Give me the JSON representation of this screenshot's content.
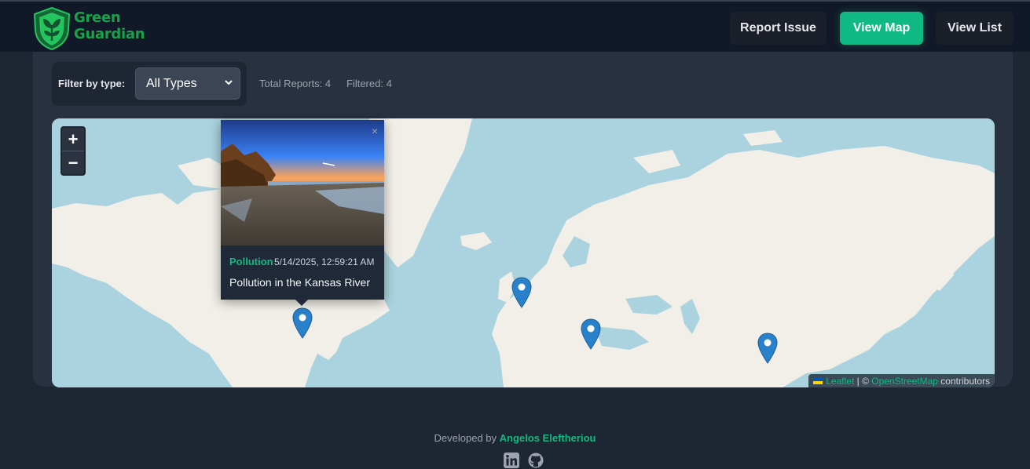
{
  "brand": {
    "line1": "Green",
    "line2": "Guardian"
  },
  "nav": {
    "report_label": "Report Issue",
    "map_label": "View Map",
    "list_label": "View List"
  },
  "filter": {
    "label": "Filter by type:",
    "selected": "All Types",
    "total_reports": "Total Reports: 4",
    "filtered": "Filtered: 4"
  },
  "map": {
    "zoom_in": "+",
    "zoom_out": "−",
    "attribution": {
      "leaflet": "Leaflet",
      "separator": " | © ",
      "osm": "OpenStreetMap",
      "suffix": " contributors"
    },
    "marker_count": 4
  },
  "popup": {
    "type": "Pollution",
    "date": "5/14/2025, 12:59:21 AM",
    "description": "Pollution in the Kansas River",
    "close": "×"
  },
  "footer": {
    "prefix": "Developed by ",
    "author": "Angelos Eleftheriou"
  },
  "colors": {
    "accent": "#10b981",
    "header_bg": "#111827",
    "page_bg": "#1f2633",
    "panel_bg": "#283140",
    "water": "#aad3df",
    "land": "#f2efe9",
    "marker": "#2a81cb"
  },
  "icons": [
    "shield-leaf-logo",
    "select-chevron-icon",
    "map-marker-icon",
    "linkedin-icon",
    "github-icon"
  ]
}
